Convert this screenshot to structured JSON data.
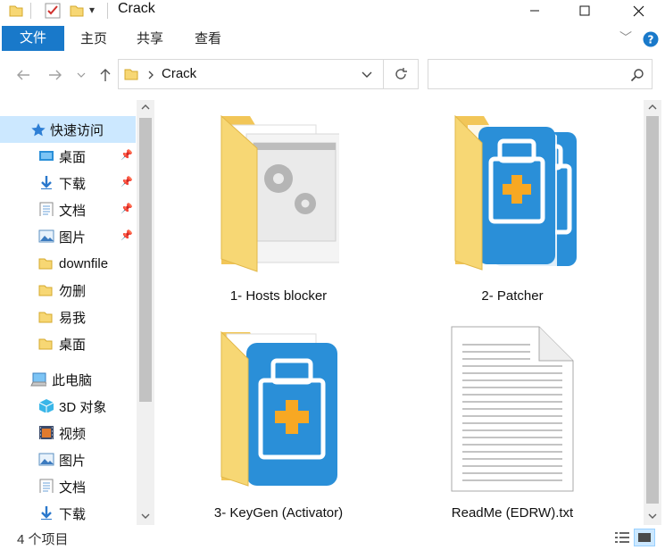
{
  "window": {
    "title": "Crack"
  },
  "ribbon": {
    "tabs": [
      "文件",
      "主页",
      "共享",
      "查看"
    ]
  },
  "address": {
    "path": [
      "Crack"
    ]
  },
  "nav": {
    "quick_access": "快速访问",
    "items": [
      {
        "label": "桌面",
        "icon": "desktop-icon",
        "pinned": true
      },
      {
        "label": "下载",
        "icon": "download-icon",
        "pinned": true
      },
      {
        "label": "文档",
        "icon": "document-icon",
        "pinned": true
      },
      {
        "label": "图片",
        "icon": "picture-icon",
        "pinned": true
      },
      {
        "label": "downfile",
        "icon": "folder-icon",
        "pinned": false
      },
      {
        "label": "勿删",
        "icon": "folder-icon",
        "pinned": false
      },
      {
        "label": "易我",
        "icon": "folder-icon",
        "pinned": false
      },
      {
        "label": "桌面",
        "icon": "folder-icon",
        "pinned": false
      }
    ],
    "this_pc": "此电脑",
    "pc_items": [
      {
        "label": "3D 对象",
        "icon": "3d-objects-icon"
      },
      {
        "label": "视频",
        "icon": "video-icon"
      },
      {
        "label": "图片",
        "icon": "picture-icon"
      },
      {
        "label": "文档",
        "icon": "document-icon"
      },
      {
        "label": "下载",
        "icon": "download-icon"
      }
    ]
  },
  "files": [
    {
      "name": "1- Hosts blocker",
      "icon": "folder-gears-icon"
    },
    {
      "name": "2- Patcher",
      "icon": "folder-toolbox-icon"
    },
    {
      "name": "3- KeyGen (Activator)",
      "icon": "folder-toolbox-icon"
    },
    {
      "name": "ReadMe (EDRW).txt",
      "icon": "text-file-icon"
    }
  ],
  "status": {
    "count": "4 个项目"
  },
  "colors": {
    "accent": "#1979ca",
    "folder": "#f7d774",
    "selection": "#cce8ff",
    "app_blue": "#2a8fd8",
    "plus_orange": "#f7a823"
  }
}
